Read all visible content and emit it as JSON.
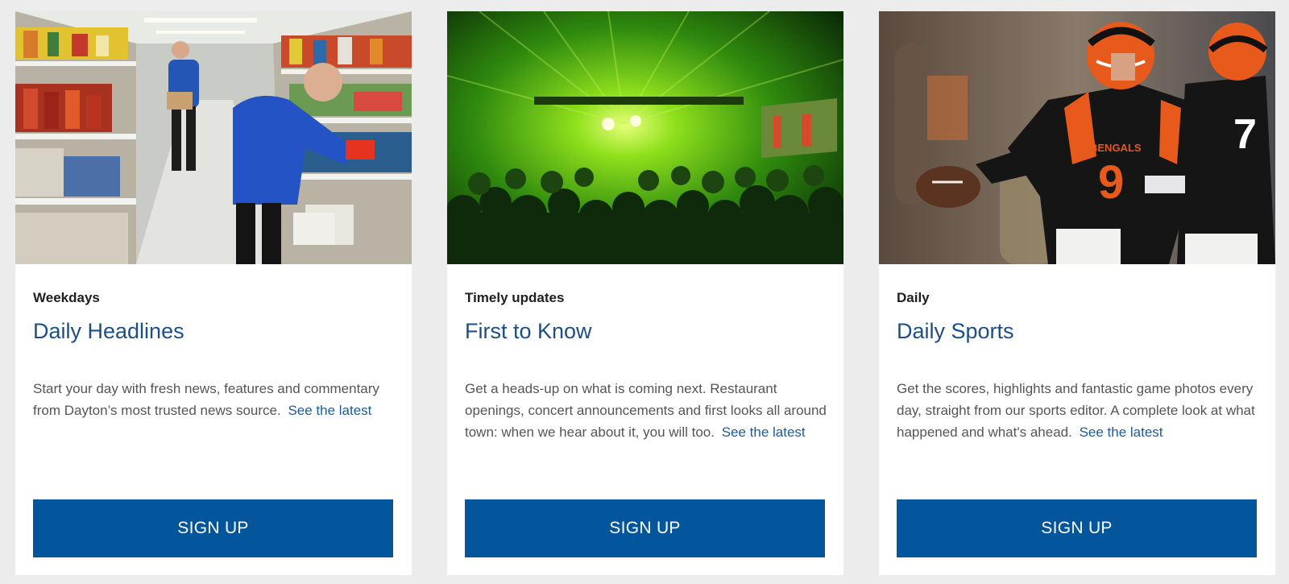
{
  "newsletters": [
    {
      "kicker": "Weekdays",
      "title": "Daily Headlines",
      "description": "Start your day with fresh news, features and commentary from Dayton’s most trusted news source.",
      "link_label": "See the latest",
      "button_label": "SIGN UP",
      "image_icon": "grocery-store-photo"
    },
    {
      "kicker": "Timely updates",
      "title": "First to Know",
      "description": "Get a heads-up on what is coming next. Restaurant openings, concert announcements and first looks all around town: when we hear about it, you will too.",
      "link_label": "See the latest",
      "button_label": "SIGN UP",
      "image_icon": "concert-crowd-photo"
    },
    {
      "kicker": "Daily",
      "title": "Daily Sports",
      "description": "Get the scores, highlights and fantastic game photos every day, straight from our sports editor. A complete look at what happened and what's ahead.",
      "link_label": "See the latest",
      "button_label": "SIGN UP",
      "image_icon": "football-players-photo",
      "jersey_text": "BENGALS",
      "jersey_number": "9"
    }
  ],
  "colors": {
    "title": "#1c4f86",
    "link": "#1f5b94",
    "button": "#03559c",
    "background": "#ececec"
  }
}
